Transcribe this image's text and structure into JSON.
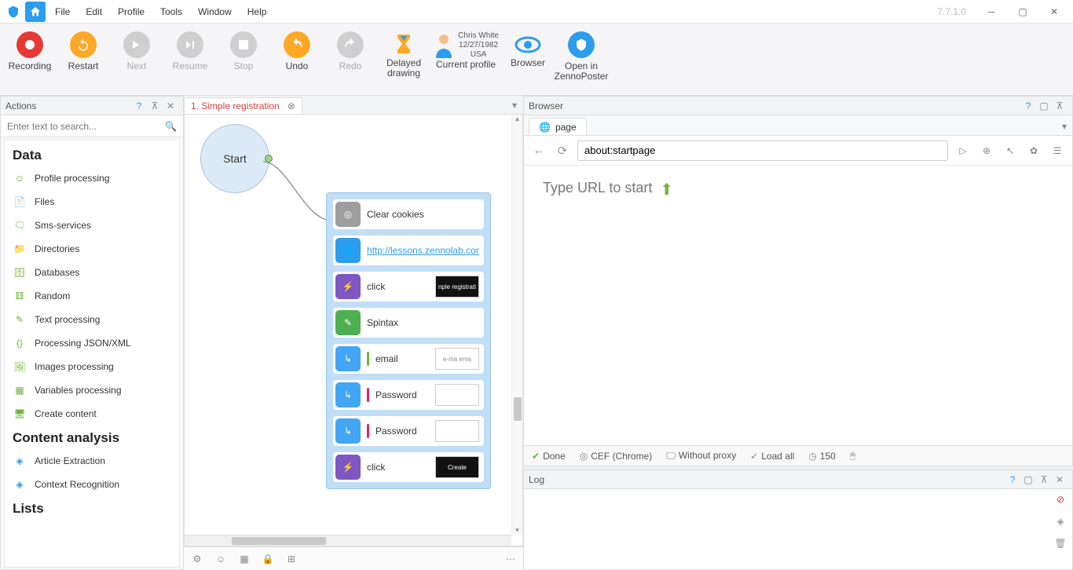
{
  "app": {
    "version": "7.7.1.0"
  },
  "menu": [
    "File",
    "Edit",
    "Profile",
    "Tools",
    "Window",
    "Help"
  ],
  "toolbar": {
    "recording": "Recording",
    "restart": "Restart",
    "next": "Next",
    "resume": "Resume",
    "stop": "Stop",
    "undo": "Undo",
    "redo": "Redo",
    "delayed": "Delayed drawing",
    "profile": "Current profile",
    "browser": "Browser",
    "openin": "Open in ZennoPoster"
  },
  "profile": {
    "name": "Chris White",
    "date": "12/27/1982",
    "country": "USA"
  },
  "actions": {
    "title": "Actions",
    "search_placeholder": "Enter text to search...",
    "sections": {
      "data": "Data",
      "content_analysis": "Content analysis",
      "lists": "Lists"
    },
    "data_items": [
      "Profile processing",
      "Files",
      "Sms-services",
      "Directories",
      "Databases",
      "Random",
      "Text processing",
      "Processing JSON/XML",
      "Images processing",
      "Variables processing",
      "Create content"
    ],
    "ca_items": [
      "Article Extraction",
      "Context Recognition"
    ]
  },
  "canvas": {
    "tab": "1. Simple registration",
    "start": "Start",
    "steps": [
      {
        "icon": "gray",
        "label": "Clear cookies"
      },
      {
        "icon": "blue",
        "label": "http://lessons.zennolab.com/en/index",
        "link": true
      },
      {
        "icon": "purple",
        "label": "click",
        "thumb": "nple registrati",
        "thumbDark": true
      },
      {
        "icon": "green",
        "label": "Spintax"
      },
      {
        "icon": "iblue",
        "bar": "green",
        "label": "email",
        "thumb": "e-ma ema",
        "thumbDark": false
      },
      {
        "icon": "iblue",
        "bar": "pink",
        "label": "Password",
        "thumb": "",
        "thumbDark": false
      },
      {
        "icon": "iblue",
        "bar": "pink",
        "label": "Password",
        "thumb": "",
        "thumbDark": false
      },
      {
        "icon": "purple",
        "label": "click",
        "thumb": "Create",
        "thumbDark": true
      }
    ]
  },
  "browser": {
    "title": "Browser",
    "tab": "page",
    "url": "about:startpage",
    "placeholder_text": "Type URL to start",
    "status": {
      "done": "Done",
      "engine": "CEF (Chrome)",
      "proxy": "Without proxy",
      "load": "Load all",
      "timeout": "150"
    }
  },
  "log": {
    "title": "Log"
  }
}
